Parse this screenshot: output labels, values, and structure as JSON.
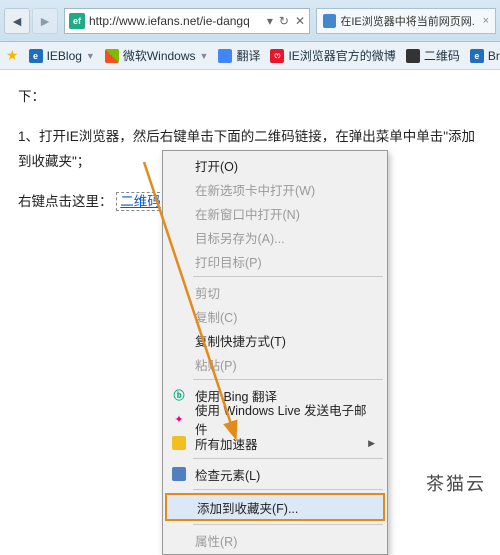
{
  "titlebar": {
    "url": "http://www.iefans.net/ie-dangq",
    "tab_title": "在IE浏览器中将当前网页网..."
  },
  "favbar": {
    "items": [
      {
        "label": "IEBlog"
      },
      {
        "label": "微软Windows"
      },
      {
        "label": "翻译"
      },
      {
        "label": "IE浏览器官方的微博"
      },
      {
        "label": "二维码"
      },
      {
        "label": "Brooksville C"
      }
    ]
  },
  "content": {
    "line0": "下：",
    "line1": "1、打开IE浏览器，然后右键单击下面的二维码链接，在弹出菜单中单击\"添加到收藏夹\"；",
    "link_prefix": "右键点击这里：",
    "link_text": "二维码"
  },
  "menu": {
    "open": "打开(O)",
    "open_newtab": "在新选项卡中打开(W)",
    "open_newwin": "在新窗口中打开(N)",
    "save_target": "目标另存为(A)...",
    "print_target": "打印目标(P)",
    "cut": "剪切",
    "copy": "复制(C)",
    "copy_shortcut": "复制快捷方式(T)",
    "paste": "粘贴(P)",
    "bing_translate": "使用 Bing 翻译",
    "live_mail": "使用 Windows Live 发送电子邮件",
    "all_acc": "所有加速器",
    "inspect": "检查元素(L)",
    "add_fav": "添加到收藏夹(F)...",
    "properties": "属性(R)"
  },
  "watermark": "茶猫云"
}
